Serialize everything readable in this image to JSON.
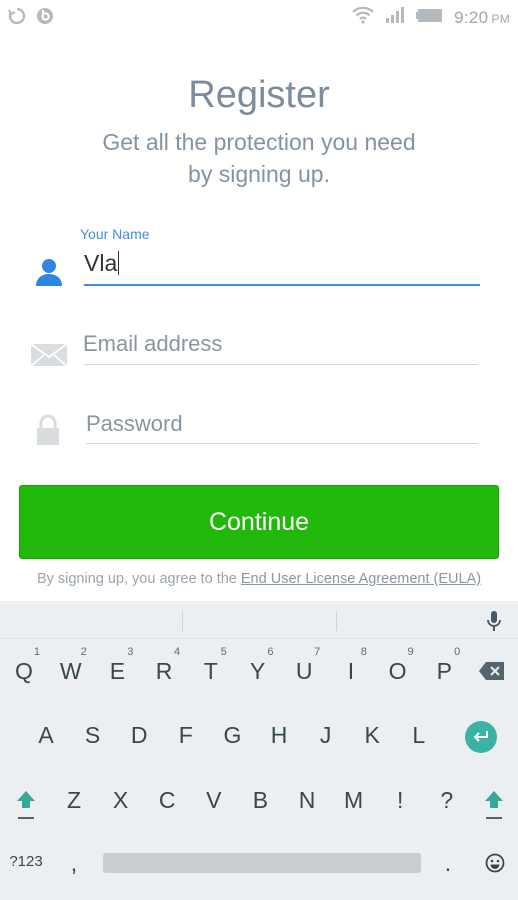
{
  "status_bar": {
    "time": "9:20",
    "ampm": "PM",
    "icons": [
      "sync-icon",
      "beats-icon",
      "wifi-icon",
      "signal-icon",
      "battery-icon"
    ]
  },
  "header": {
    "title": "Register",
    "subtitle_line1": "Get all the protection you need",
    "subtitle_line2": "by signing up."
  },
  "form": {
    "name": {
      "label": "Your Name",
      "value": "Vla",
      "icon": "person-icon"
    },
    "email": {
      "placeholder": "Email address",
      "value": "",
      "icon": "envelope-icon"
    },
    "password": {
      "placeholder": "Password",
      "value": "",
      "icon": "lock-icon"
    }
  },
  "continue_label": "Continue",
  "eula": {
    "prefix": "By signing up, you agree to the ",
    "link": "End User License Agreement (EULA)"
  },
  "colors": {
    "accent": "#3f8fe0",
    "button": "#21b80b",
    "title": "#7d8c9c"
  },
  "keyboard": {
    "row1": [
      {
        "k": "Q",
        "n": "1"
      },
      {
        "k": "W",
        "n": "2"
      },
      {
        "k": "E",
        "n": "3"
      },
      {
        "k": "R",
        "n": "4"
      },
      {
        "k": "T",
        "n": "5"
      },
      {
        "k": "Y",
        "n": "6"
      },
      {
        "k": "U",
        "n": "7"
      },
      {
        "k": "I",
        "n": "8"
      },
      {
        "k": "O",
        "n": "9"
      },
      {
        "k": "P",
        "n": "0"
      }
    ],
    "row2": [
      "A",
      "S",
      "D",
      "F",
      "G",
      "H",
      "J",
      "K",
      "L"
    ],
    "row3": [
      "Z",
      "X",
      "C",
      "V",
      "B",
      "N",
      "M",
      "!",
      "?"
    ],
    "symbols_label": "?123",
    "comma": ",",
    "period": ".",
    "icons": [
      "mic-icon",
      "backspace-icon",
      "enter-icon",
      "shift-icon",
      "emoji-icon"
    ]
  }
}
